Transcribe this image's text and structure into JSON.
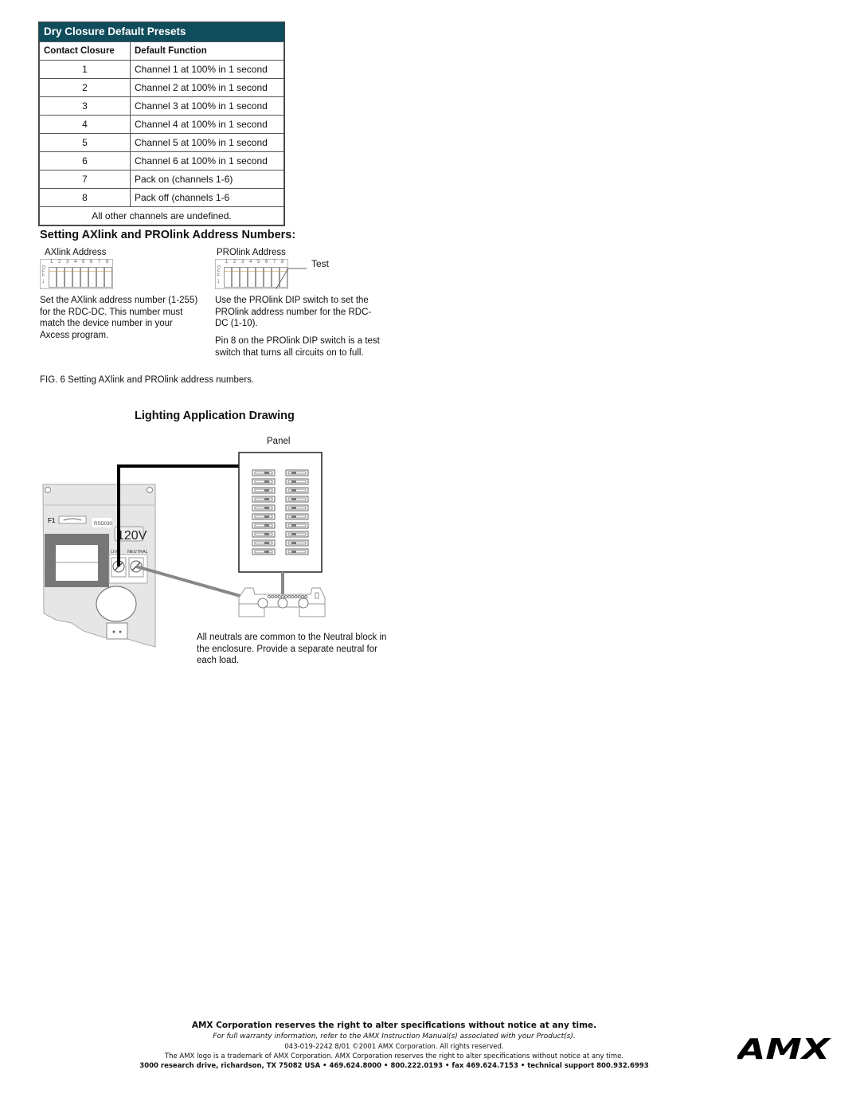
{
  "presets_table": {
    "title": "Dry Closure Default Presets",
    "headers": [
      "Contact Closure",
      "Default Function"
    ],
    "rows": [
      {
        "closure": "1",
        "function": "Channel 1 at 100% in 1 second"
      },
      {
        "closure": "2",
        "function": "Channel 2 at 100% in 1 second"
      },
      {
        "closure": "3",
        "function": "Channel 3 at 100% in 1 second"
      },
      {
        "closure": "4",
        "function": "Channel 4 at 100% in 1 second"
      },
      {
        "closure": "5",
        "function": "Channel 5 at 100% in 1 second"
      },
      {
        "closure": "6",
        "function": "Channel 6 at 100% in 1 second"
      },
      {
        "closure": "7",
        "function": "Pack on (channels 1-6)"
      },
      {
        "closure": "8",
        "function": "Pack off (channels 1-6"
      }
    ],
    "footer": "All other channels are undefined."
  },
  "address_section": {
    "heading": "Setting AXlink and PROlink Address Numbers:",
    "axlink": {
      "label": "AXlink Address",
      "description": "Set the AXlink address number (1-255) for the RDC-DC. This number must match the device number in your Axcess program."
    },
    "prolink": {
      "label": "PROlink Address",
      "test_label": "Test",
      "description_1": "Use the PROlink DIP switch to set the PROlink address number for the RDC-DC (1-10).",
      "description_2": "Pin 8 on the PROlink DIP switch is a test switch that turns all circuits on to full."
    },
    "dip_numbers": [
      "1",
      "2",
      "3",
      "4",
      "5",
      "6",
      "7",
      "8"
    ],
    "dip_off_label": "OFF",
    "figure_caption": "FIG. 6  Setting AXlink and PROlink address numbers."
  },
  "lighting_section": {
    "heading": "Lighting Application Drawing",
    "panel_label": "Panel",
    "device_voltage": "120V",
    "device_live": "LIVE",
    "device_neutral": "NEUTRAL",
    "device_fuse": "F1",
    "device_part": "RSD030",
    "note": "All neutrals are common to the Neutral block in the enclosure. Provide a separate neutral for each load."
  },
  "footer": {
    "line1": "AMX Corporation reserves the right to alter specifications without notice at any time.",
    "line2": "For full warranty information, refer to the AMX Instruction Manual(s) associated with your Product(s).",
    "line3": "043-019-2242  8/01  ©2001 AMX Corporation. All rights reserved.",
    "line4": "The AMX logo is a trademark of AMX Corporation. AMX Corporation reserves the right to alter specifications without notice at any time.",
    "line5": "3000 research drive, richardson, TX 75082 USA • 469.624.8000 • 800.222.0193 • fax 469.624.7153 • technical support 800.932.6993",
    "logo_text": "AMX"
  }
}
